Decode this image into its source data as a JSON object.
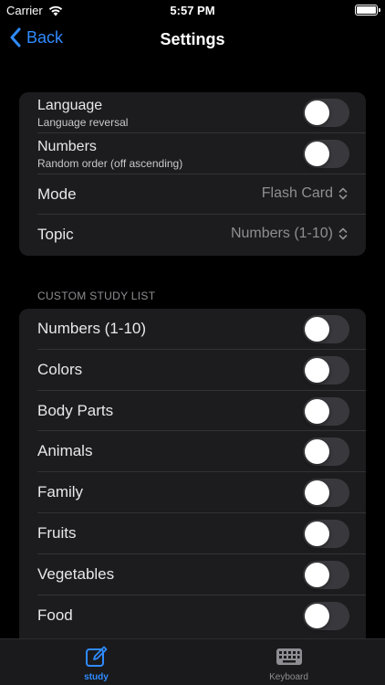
{
  "status_bar": {
    "carrier": "Carrier",
    "time": "5:57 PM"
  },
  "nav": {
    "back_label": "Back",
    "title": "Settings"
  },
  "settings_group": [
    {
      "label": "Language",
      "sub": "Language reversal",
      "type": "toggle",
      "on": false
    },
    {
      "label": "Numbers",
      "sub": "Random order (off ascending)",
      "type": "toggle",
      "on": false
    },
    {
      "label": "Mode",
      "value": "Flash Card",
      "type": "picker"
    },
    {
      "label": "Topic",
      "value": "Numbers (1-10)",
      "type": "picker"
    }
  ],
  "custom_study": {
    "header": "CUSTOM STUDY LIST",
    "items": [
      {
        "label": "Numbers (1-10)",
        "on": false
      },
      {
        "label": "Colors",
        "on": false
      },
      {
        "label": "Body Parts",
        "on": false
      },
      {
        "label": "Animals",
        "on": false
      },
      {
        "label": "Family",
        "on": false
      },
      {
        "label": "Fruits",
        "on": false
      },
      {
        "label": "Vegetables",
        "on": false
      },
      {
        "label": "Food",
        "on": false
      }
    ]
  },
  "tabs": [
    {
      "label": "study",
      "icon": "edit-icon",
      "active": true
    },
    {
      "label": "Keyboard",
      "icon": "keyboard-icon",
      "active": false
    }
  ],
  "colors": {
    "accent": "#2f8bff",
    "background": "#000000",
    "group": "#1c1c1e",
    "toggle_off": "#39393d"
  }
}
